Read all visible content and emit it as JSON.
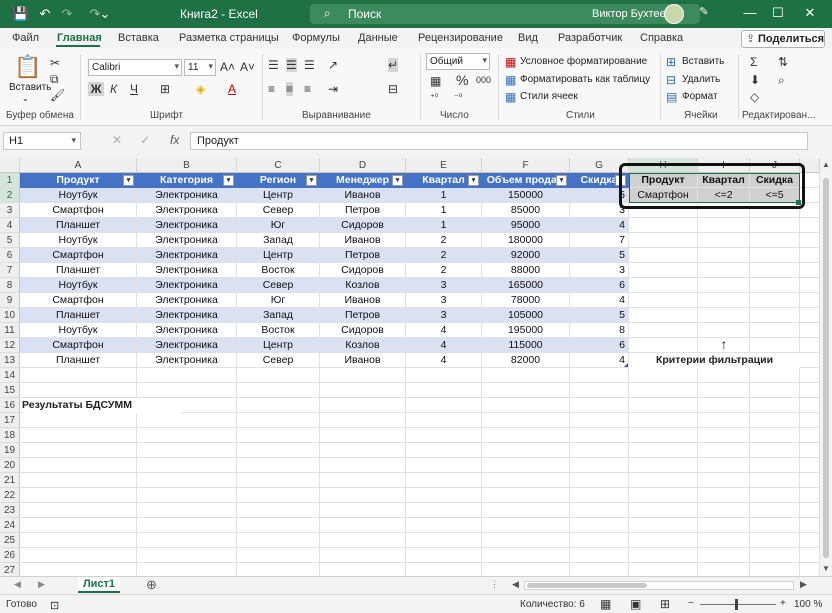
{
  "titlebar": {
    "title": "Книга2  -  Excel",
    "search_placeholder": "Поиск",
    "user": "Виктор Бухтеев",
    "save_icon": "save-icon",
    "undo_icon": "undo-icon",
    "redo_icon": "redo-icon",
    "customize_icon": "customize-icon",
    "minimize": "—",
    "maximize": "☐",
    "close": "✕"
  },
  "menu": {
    "items": [
      "Файл",
      "Главная",
      "Вставка",
      "Разметка страницы",
      "Формулы",
      "Данные",
      "Рецензирование",
      "Вид",
      "Разработчик",
      "Справка"
    ],
    "share": "Поделиться"
  },
  "ribbon": {
    "clipboard": {
      "paste": "Вставить",
      "label": "Буфер обмена"
    },
    "font": {
      "name": "Calibri",
      "size": "11",
      "label": "Шрифт",
      "bold": "Ж",
      "italic": "К",
      "underline": "Ч"
    },
    "alignment": {
      "label": "Выравнивание"
    },
    "number": {
      "format": "Общий",
      "percent": "%",
      "thousands": "000",
      "label": "Число"
    },
    "styles": {
      "conditional": "Условное форматирование",
      "table": "Форматировать как таблицу",
      "cell_styles": "Стили ячеек",
      "label": "Стили"
    },
    "cells": {
      "insert": "Вставить",
      "delete": "Удалить",
      "format": "Формат",
      "label": "Ячейки"
    },
    "editing": {
      "label": "Редактирован..."
    }
  },
  "formula_bar": {
    "name_box": "H1",
    "fx": "fx",
    "content": "Продукт"
  },
  "columns": [
    "A",
    "B",
    "C",
    "D",
    "E",
    "F",
    "G",
    "H",
    "I",
    "J"
  ],
  "table": {
    "headers": [
      "Продукт",
      "Категория",
      "Регион",
      "Менеджер",
      "Квартал",
      "Объем продаж",
      "Скидка"
    ],
    "rows": [
      [
        "Ноутбук",
        "Электроника",
        "Центр",
        "Иванов",
        "1",
        "150000",
        "5"
      ],
      [
        "Смартфон",
        "Электроника",
        "Север",
        "Петров",
        "1",
        "85000",
        "3"
      ],
      [
        "Планшет",
        "Электроника",
        "Юг",
        "Сидоров",
        "1",
        "95000",
        "4"
      ],
      [
        "Ноутбук",
        "Электроника",
        "Запад",
        "Иванов",
        "2",
        "180000",
        "7"
      ],
      [
        "Смартфон",
        "Электроника",
        "Центр",
        "Петров",
        "2",
        "92000",
        "5"
      ],
      [
        "Планшет",
        "Электроника",
        "Восток",
        "Сидоров",
        "2",
        "88000",
        "3"
      ],
      [
        "Ноутбук",
        "Электроника",
        "Север",
        "Козлов",
        "3",
        "165000",
        "6"
      ],
      [
        "Смартфон",
        "Электроника",
        "Юг",
        "Иванов",
        "3",
        "78000",
        "4"
      ],
      [
        "Планшет",
        "Электроника",
        "Запад",
        "Петров",
        "3",
        "105000",
        "5"
      ],
      [
        "Ноутбук",
        "Электроника",
        "Восток",
        "Сидоров",
        "4",
        "195000",
        "8"
      ],
      [
        "Смартфон",
        "Электроника",
        "Центр",
        "Козлов",
        "4",
        "115000",
        "6"
      ],
      [
        "Планшет",
        "Электроника",
        "Север",
        "Иванов",
        "4",
        "82000",
        "4"
      ]
    ]
  },
  "criteria": {
    "headers": [
      "Продукт",
      "Квартал",
      "Скидка"
    ],
    "values": [
      "Смартфон",
      "<=2",
      "<=5"
    ],
    "arrow": "↑",
    "caption": "Критерии фильтрации"
  },
  "results_label": "Результаты БДСУММ",
  "sheet_tab": "Лист1",
  "status": {
    "ready": "Готово",
    "count": "Количество: 6",
    "zoom": "100 %"
  }
}
